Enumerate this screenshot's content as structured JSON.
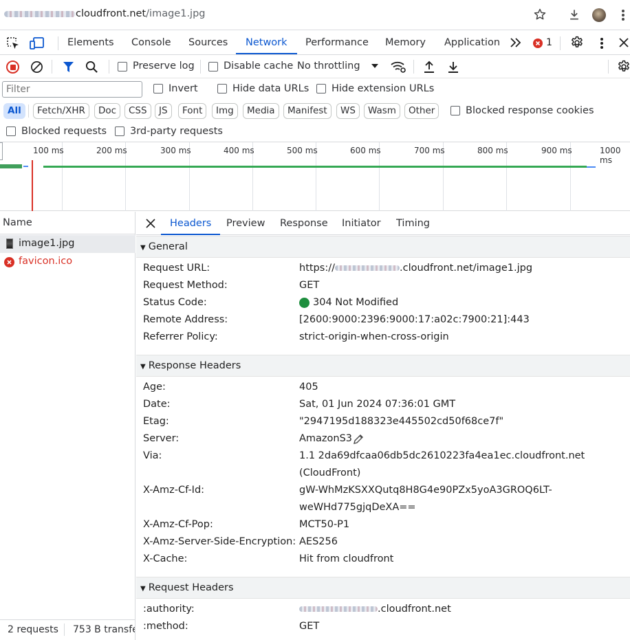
{
  "address_bar": {
    "url_domain": "cloudfront.net",
    "url_path": "/image1.jpg"
  },
  "devtools_tabs": [
    "Elements",
    "Console",
    "Sources",
    "Network",
    "Performance",
    "Memory",
    "Application"
  ],
  "error_count": "1",
  "toolbar": {
    "preserve_log": "Preserve log",
    "disable_cache": "Disable cache",
    "throttling": "No throttling"
  },
  "filter": {
    "placeholder": "Filter",
    "invert": "Invert",
    "hide_data_urls": "Hide data URLs",
    "hide_extension_urls": "Hide extension URLs"
  },
  "type_filters": [
    "All",
    "Fetch/XHR",
    "Doc",
    "CSS",
    "JS",
    "Font",
    "Img",
    "Media",
    "Manifest",
    "WS",
    "Wasm",
    "Other"
  ],
  "blocked_response_cookies": "Blocked response cookies",
  "blocked_requests": "Blocked requests",
  "third_party_requests": "3rd-party requests",
  "timeline_ticks": [
    "100 ms",
    "200 ms",
    "300 ms",
    "400 ms",
    "500 ms",
    "600 ms",
    "700 ms",
    "800 ms",
    "900 ms",
    "1000 ms"
  ],
  "requests": {
    "header": "Name",
    "items": [
      "image1.jpg",
      "favicon.ico"
    ]
  },
  "status_bar": {
    "count": "2 requests",
    "transferred": "753 B transfe"
  },
  "detail_tabs": [
    "Headers",
    "Preview",
    "Response",
    "Initiator",
    "Timing"
  ],
  "general": {
    "title": "General",
    "request_url_label": "Request URL:",
    "request_url_prefix": "https://",
    "request_url_suffix": ".cloudfront.net/image1.jpg",
    "request_method_label": "Request Method:",
    "request_method": "GET",
    "status_code_label": "Status Code:",
    "status_code": "304 Not Modified",
    "status_color": "#1e8e3e",
    "remote_address_label": "Remote Address:",
    "remote_address": "[2600:9000:2396:9000:17:a02c:7900:21]:443",
    "referrer_policy_label": "Referrer Policy:",
    "referrer_policy": "strict-origin-when-cross-origin"
  },
  "response_headers": {
    "title": "Response Headers",
    "age_label": "Age:",
    "age": "405",
    "date_label": "Date:",
    "date": "Sat, 01 Jun 2024 07:36:01 GMT",
    "etag_label": "Etag:",
    "etag": "\"2947195d188323e445502cd50f68ce7f\"",
    "server_label": "Server:",
    "server": "AmazonS3",
    "via_label": "Via:",
    "via_line1": "1.1 2da69dfcaa06db5dc2610223fa4ea1ec.cloudfront.net",
    "via_line2": "(CloudFront)",
    "cf_id_label": "X-Amz-Cf-Id:",
    "cf_id_line1": "gW-WhMzKSXXQutq8H8G4e90PZx5yoA3GROQ6LT-",
    "cf_id_line2": "weWHd775gjqDeXA==",
    "cf_pop_label": "X-Amz-Cf-Pop:",
    "cf_pop": "MCT50-P1",
    "sse_label": "X-Amz-Server-Side-Encryption:",
    "sse": "AES256",
    "x_cache_label": "X-Cache:",
    "x_cache": "Hit from cloudfront"
  },
  "request_headers": {
    "title": "Request Headers",
    "authority_label": ":authority:",
    "authority_suffix": ".cloudfront.net",
    "method_label": ":method:",
    "method": "GET"
  },
  "colors": {
    "accent": "#0b57d0",
    "error": "#d93025",
    "success": "#1e8e3e"
  }
}
